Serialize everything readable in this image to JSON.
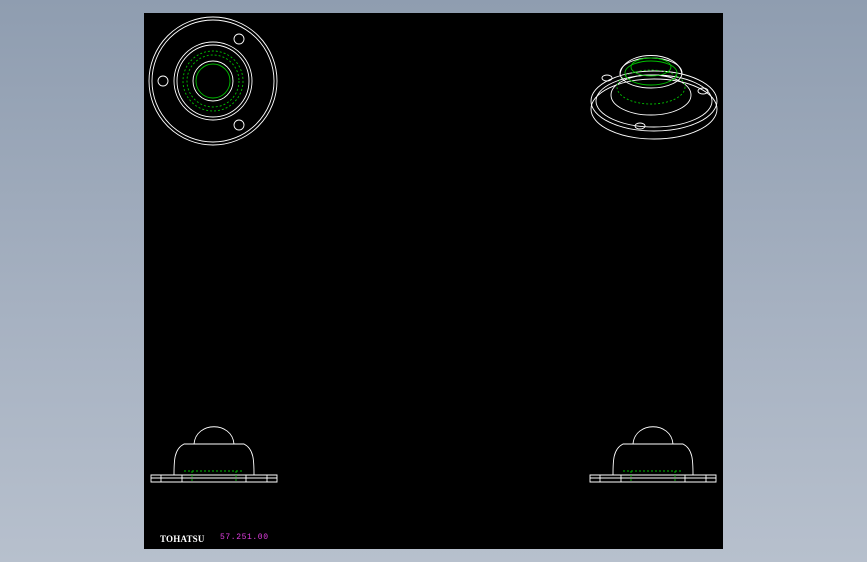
{
  "drawing": {
    "brand_label": "TOHATSU",
    "part_number": "57.251.00",
    "part_number_color": "#e23ee2",
    "line_color": "#ffffff",
    "hidden_line_color": "#00c000",
    "background_color": "#000000"
  },
  "views": [
    {
      "name": "top-view"
    },
    {
      "name": "isometric-view"
    },
    {
      "name": "front-view"
    },
    {
      "name": "side-view"
    }
  ]
}
